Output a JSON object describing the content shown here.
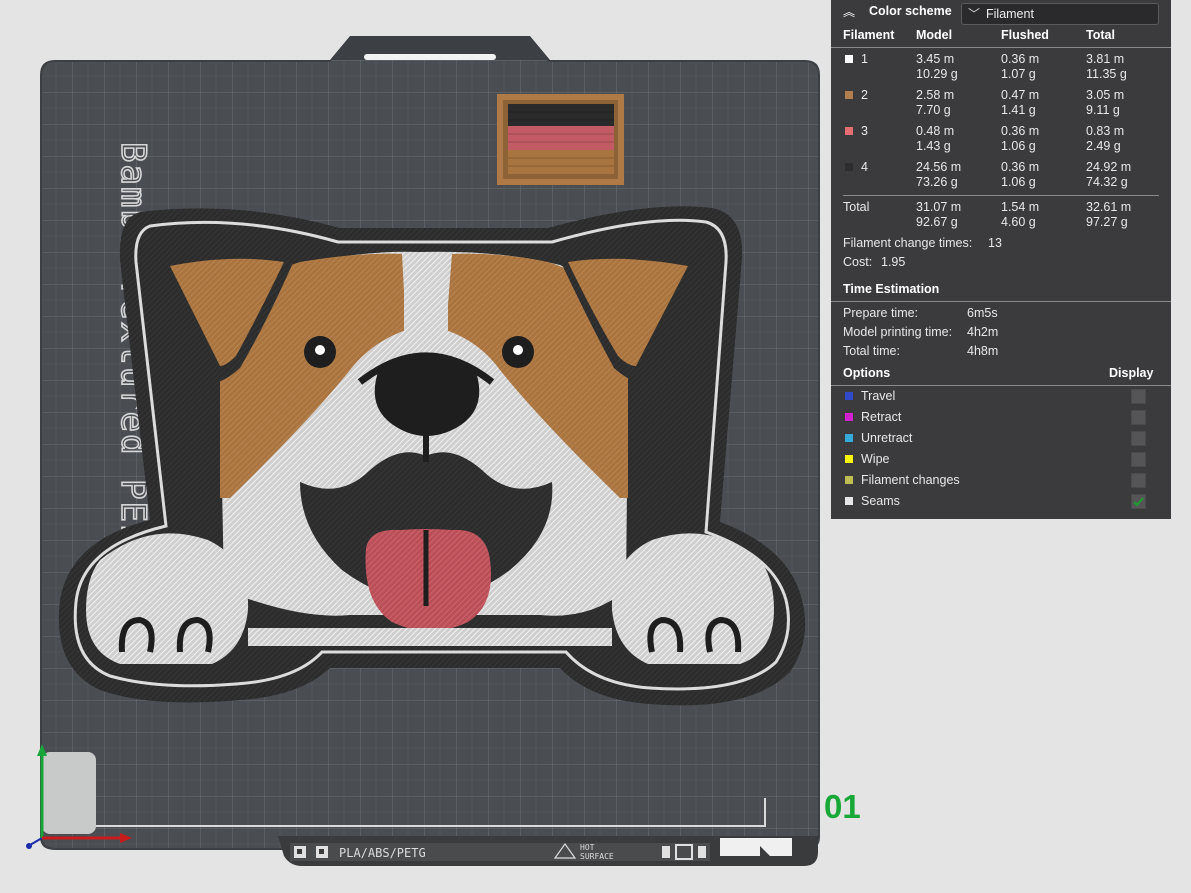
{
  "color_scheme": {
    "label": "Color scheme",
    "value": "Filament"
  },
  "filament_table": {
    "headers": [
      "Filament",
      "Model",
      "Flushed",
      "Total"
    ],
    "rows": [
      {
        "id": "1",
        "color": "#ffffff",
        "model_len": "3.45 m",
        "model_wt": "10.29 g",
        "flushed_len": "0.36 m",
        "flushed_wt": "1.07 g",
        "total_len": "3.81 m",
        "total_wt": "11.35 g"
      },
      {
        "id": "2",
        "color": "#b07d4f",
        "model_len": "2.58 m",
        "model_wt": "7.70 g",
        "flushed_len": "0.47 m",
        "flushed_wt": "1.41 g",
        "total_len": "3.05 m",
        "total_wt": "9.11 g"
      },
      {
        "id": "3",
        "color": "#e46d73",
        "model_len": "0.48 m",
        "model_wt": "1.43 g",
        "flushed_len": "0.36 m",
        "flushed_wt": "1.06 g",
        "total_len": "0.83 m",
        "total_wt": "2.49 g"
      },
      {
        "id": "4",
        "color": "#2d2d2d",
        "model_len": "24.56 m",
        "model_wt": "73.26 g",
        "flushed_len": "0.36 m",
        "flushed_wt": "1.06 g",
        "total_len": "24.92 m",
        "total_wt": "74.32 g"
      }
    ],
    "total": {
      "label": "Total",
      "model_len": "31.07 m",
      "model_wt": "92.67 g",
      "flushed_len": "1.54 m",
      "flushed_wt": "4.60 g",
      "total_len": "32.61 m",
      "total_wt": "97.27 g"
    }
  },
  "filament_change": {
    "label": "Filament change times:",
    "value": "13"
  },
  "cost": {
    "label": "Cost:",
    "value": "1.95"
  },
  "time_estimation": {
    "title": "Time Estimation",
    "prepare_label": "Prepare time:",
    "prepare": "6m5s",
    "model_label": "Model printing time:",
    "model": "4h2m",
    "total_label": "Total time:",
    "total": "4h8m"
  },
  "options": {
    "title": "Options",
    "display_label": "Display",
    "items": [
      {
        "label": "Travel",
        "color": "#2f49c9",
        "checked": false
      },
      {
        "label": "Retract",
        "color": "#d21fd2",
        "checked": false
      },
      {
        "label": "Unretract",
        "color": "#37aadd",
        "checked": false
      },
      {
        "label": "Wipe",
        "color": "#f5f508",
        "checked": false
      },
      {
        "label": "Filament changes",
        "color": "#bdbd52",
        "checked": false
      },
      {
        "label": "Seams",
        "color": "#e6e6e6",
        "checked": true
      }
    ]
  },
  "plate": {
    "number": "01",
    "bed_label": "Bambu Textured PEI P",
    "materials_label": "PLA/ABS/PETG",
    "hot_surface_top": "HOT",
    "hot_surface_bottom": "SURFACE"
  },
  "colors": {
    "accent_green": "#17a838",
    "checkmark": "#1c9e2c"
  }
}
